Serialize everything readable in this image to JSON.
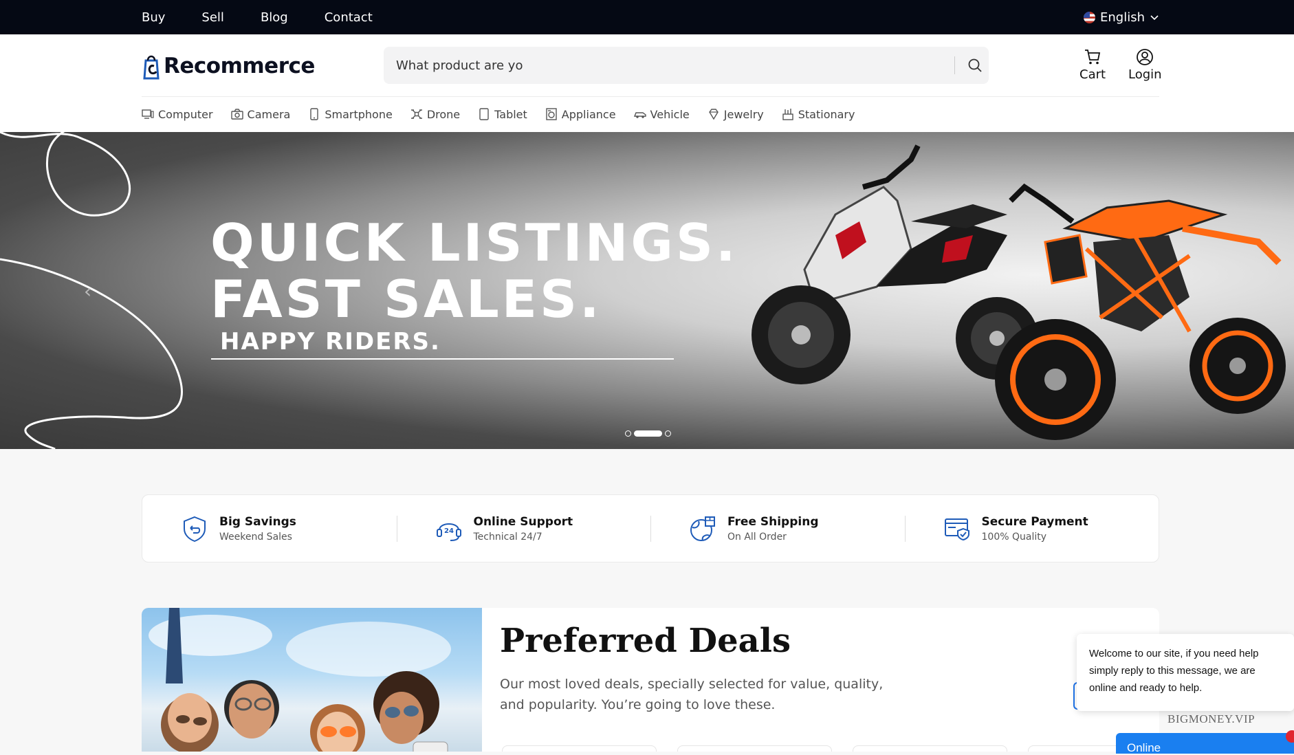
{
  "topbar": {
    "nav": [
      "Buy",
      "Sell",
      "Blog",
      "Contact"
    ],
    "language": "English"
  },
  "header": {
    "logo_text": "Recommerce",
    "search_placeholder": "What product are yo",
    "cart_label": "Cart",
    "login_label": "Login"
  },
  "categories": [
    {
      "label": "Computer",
      "icon": "computer-icon"
    },
    {
      "label": "Camera",
      "icon": "camera-icon"
    },
    {
      "label": "Smartphone",
      "icon": "smartphone-icon"
    },
    {
      "label": "Drone",
      "icon": "drone-icon"
    },
    {
      "label": "Tablet",
      "icon": "tablet-icon"
    },
    {
      "label": "Appliance",
      "icon": "appliance-icon"
    },
    {
      "label": "Vehicle",
      "icon": "vehicle-icon"
    },
    {
      "label": "Jewelry",
      "icon": "jewelry-icon"
    },
    {
      "label": "Stationary",
      "icon": "stationary-icon"
    }
  ],
  "hero": {
    "line1": "QUICK LISTINGS.",
    "line2": "FAST SALES.",
    "line3": "HAPPY RIDERS.",
    "slides_total": 3,
    "active_slide": 2
  },
  "features": [
    {
      "title": "Big Savings",
      "subtitle": "Weekend Sales",
      "icon": "shield-refund-icon"
    },
    {
      "title": "Online Support",
      "subtitle": "Technical 24/7",
      "icon": "headset-24-icon"
    },
    {
      "title": "Free Shipping",
      "subtitle": "On All Order",
      "icon": "globe-box-icon"
    },
    {
      "title": "Secure Payment",
      "subtitle": "100% Quality",
      "icon": "card-shield-icon"
    }
  ],
  "deals": {
    "title": "Preferred Deals",
    "description": "Our most loved deals, specially selected for value, quality, and popularity. You’re going to love these."
  },
  "chat": {
    "message": "Welcome to our site, if you need help simply reply to this message, we are online and ready to help.",
    "watermark": "BIGMONEY.VIP",
    "status": "Online"
  },
  "colors": {
    "topbar_bg": "#050914",
    "accent_blue": "#1e5bb8",
    "chat_blue": "#1a7ff0"
  }
}
